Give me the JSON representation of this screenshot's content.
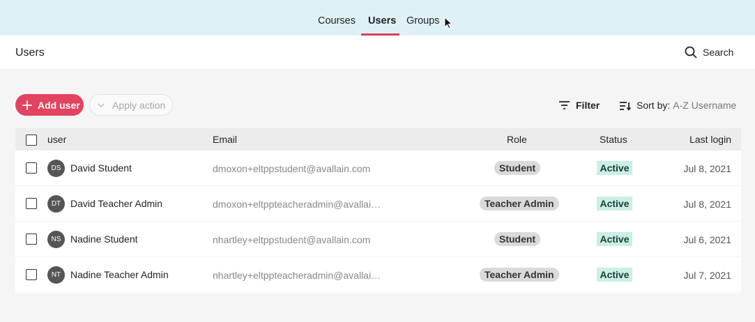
{
  "nav": {
    "tabs": [
      {
        "label": "Courses"
      },
      {
        "label": "Users"
      },
      {
        "label": "Groups"
      }
    ],
    "active": "Users"
  },
  "header": {
    "title": "Users",
    "search_label": "Search"
  },
  "toolbar": {
    "add_user_label": "Add user",
    "apply_action_label": "Apply action",
    "filter_label": "Filter",
    "sort_label": "Sort by:",
    "sort_value": "A-Z Username"
  },
  "table": {
    "columns": {
      "user": "user",
      "email": "Email",
      "role": "Role",
      "status": "Status",
      "last_login": "Last login"
    },
    "rows": [
      {
        "initials": "DS",
        "name": "David Student",
        "email": "dmoxon+eltppstudent@avallain.com",
        "role": "Student",
        "status": "Active",
        "last_login": "Jul 8, 2021"
      },
      {
        "initials": "DT",
        "name": "David Teacher Admin",
        "email": "dmoxon+eltppteacheradmin@avallain.com",
        "role": "Teacher Admin",
        "status": "Active",
        "last_login": "Jul 8, 2021"
      },
      {
        "initials": "NS",
        "name": "Nadine Student",
        "email": "nhartley+eltppstudent@avallain.com",
        "role": "Student",
        "status": "Active",
        "last_login": "Jul 6, 2021"
      },
      {
        "initials": "NT",
        "name": "Nadine Teacher Admin",
        "email": "nhartley+eltppteacheradmin@avallain.com",
        "role": "Teacher Admin",
        "status": "Active",
        "last_login": "Jul 7, 2021"
      }
    ]
  },
  "colors": {
    "accent": "#e2435f",
    "nav_background": "#e0f1f6",
    "status_active_bg": "#c9efe6",
    "role_badge_bg": "#dadada",
    "avatar_bg": "#555555"
  },
  "icons": {
    "search": "search-icon",
    "add": "plus-icon",
    "apply": "chevron-down-icon",
    "filter": "filter-icon",
    "sort": "sort-icon",
    "cursor": "mouse-pointer-icon"
  }
}
